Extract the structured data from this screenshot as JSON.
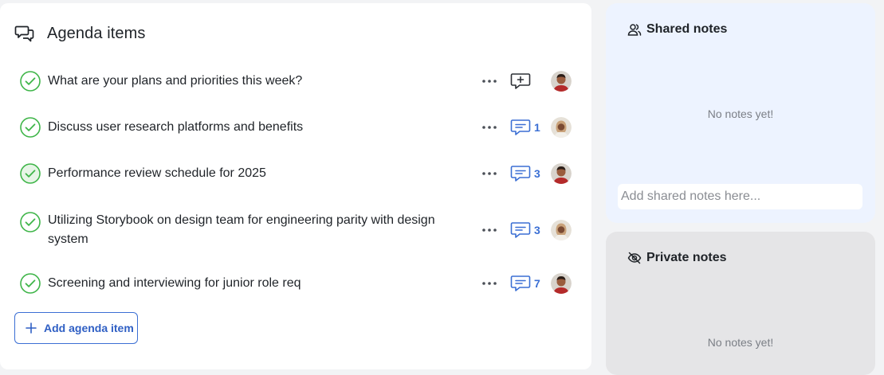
{
  "agenda": {
    "title": "Agenda items",
    "add_button_label": "Add agenda item",
    "items": [
      {
        "text": "What are your plans and priorities this week?",
        "comment_count": "",
        "avatar": "man"
      },
      {
        "text": "Discuss user research platforms and benefits",
        "comment_count": "1",
        "avatar": "woman"
      },
      {
        "text": "Performance review schedule for 2025",
        "comment_count": "3",
        "avatar": "man"
      },
      {
        "text": "Utilizing Storybook on design team for engineering parity with design system",
        "comment_count": "3",
        "avatar": "woman"
      },
      {
        "text": "Screening and interviewing for junior role req",
        "comment_count": "7",
        "avatar": "man"
      }
    ]
  },
  "shared_notes": {
    "title": "Shared notes",
    "empty_text": "No notes yet!",
    "placeholder": "Add shared notes here..."
  },
  "private_notes": {
    "title": "Private notes",
    "empty_text": "No notes yet!"
  },
  "colors": {
    "accent": "#3b6fd4",
    "check_green": "#3fb549",
    "shared_bg": "#edf3ff",
    "private_bg": "#e5e5e7"
  }
}
